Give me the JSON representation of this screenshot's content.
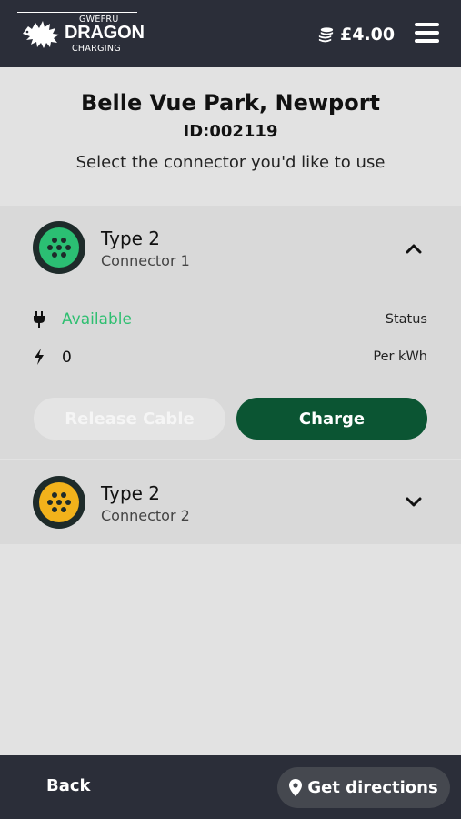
{
  "header": {
    "logo": {
      "line1": "GWEFRU",
      "line2": "DRAGON",
      "line3": "CHARGING"
    },
    "balance": "£4.00",
    "icons": {
      "balance": "coins-icon",
      "menu": "hamburger-menu-icon"
    }
  },
  "site": {
    "name": "Belle Vue Park, Newport",
    "id": "ID:002119",
    "hint": "Select the connector you'd like to use"
  },
  "connectors": [
    {
      "title": "Type 2",
      "subtitle": "Connector 1",
      "icon_color": "#2bbf73",
      "expanded": true,
      "status_value": "Available",
      "status_label": "Status",
      "price_value": "0",
      "price_label": "Per kWh",
      "release_label": "Release Cable",
      "charge_label": "Charge"
    },
    {
      "title": "Type 2",
      "subtitle": "Connector 2",
      "icon_color": "#f2b21b",
      "expanded": false
    }
  ],
  "footer": {
    "back_label": "Back",
    "directions_label": "Get directions"
  },
  "colors": {
    "topbar": "#2b2e39",
    "background": "#e2e2e2",
    "available": "#2fbf71",
    "charge_button": "#0b5533"
  }
}
